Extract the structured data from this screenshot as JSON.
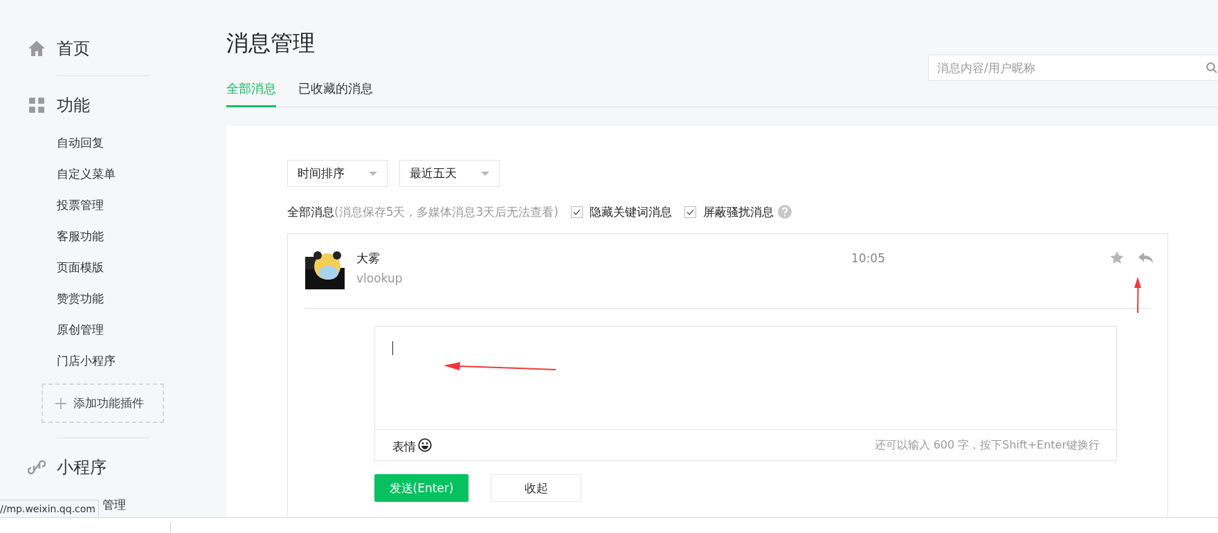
{
  "sidebar": {
    "sections": [
      {
        "label": "首页"
      },
      {
        "label": "功能",
        "items": [
          {
            "label": "自动回复"
          },
          {
            "label": "自定义菜单"
          },
          {
            "label": "投票管理"
          },
          {
            "label": "客服功能"
          },
          {
            "label": "页面模版"
          },
          {
            "label": "赞赏功能"
          },
          {
            "label": "原创管理"
          },
          {
            "label": "门店小程序"
          }
        ],
        "add_button": "添加功能插件"
      },
      {
        "label": "小程序",
        "items": [
          {
            "label": "管理"
          }
        ]
      }
    ]
  },
  "page": {
    "title": "消息管理",
    "search": {
      "placeholder": "消息内容/用户昵称"
    },
    "tabs": [
      {
        "label": "全部消息",
        "selected": true
      },
      {
        "label": "已收藏的消息",
        "selected": false
      }
    ]
  },
  "filters": [
    {
      "value": "时间排序"
    },
    {
      "value": "最近五天"
    }
  ],
  "info": {
    "label": "全部消息",
    "note": "(消息保存5天，多媒体消息3天后无法查看)"
  },
  "options": [
    {
      "label": "隐藏关键词消息",
      "checked": true
    },
    {
      "label": "屏蔽骚扰消息",
      "checked": true
    }
  ],
  "messages": [
    {
      "name": "大雾",
      "text": "vlookup",
      "time": "10:05",
      "starred": false
    }
  ],
  "reply": {
    "emoji_label": "表情",
    "counter": "还可以输入 600 字，按下Shift+Enter键换行",
    "send": "发送(Enter)",
    "collapse": "收起"
  },
  "status_url": "//mp.weixin.qq.com"
}
